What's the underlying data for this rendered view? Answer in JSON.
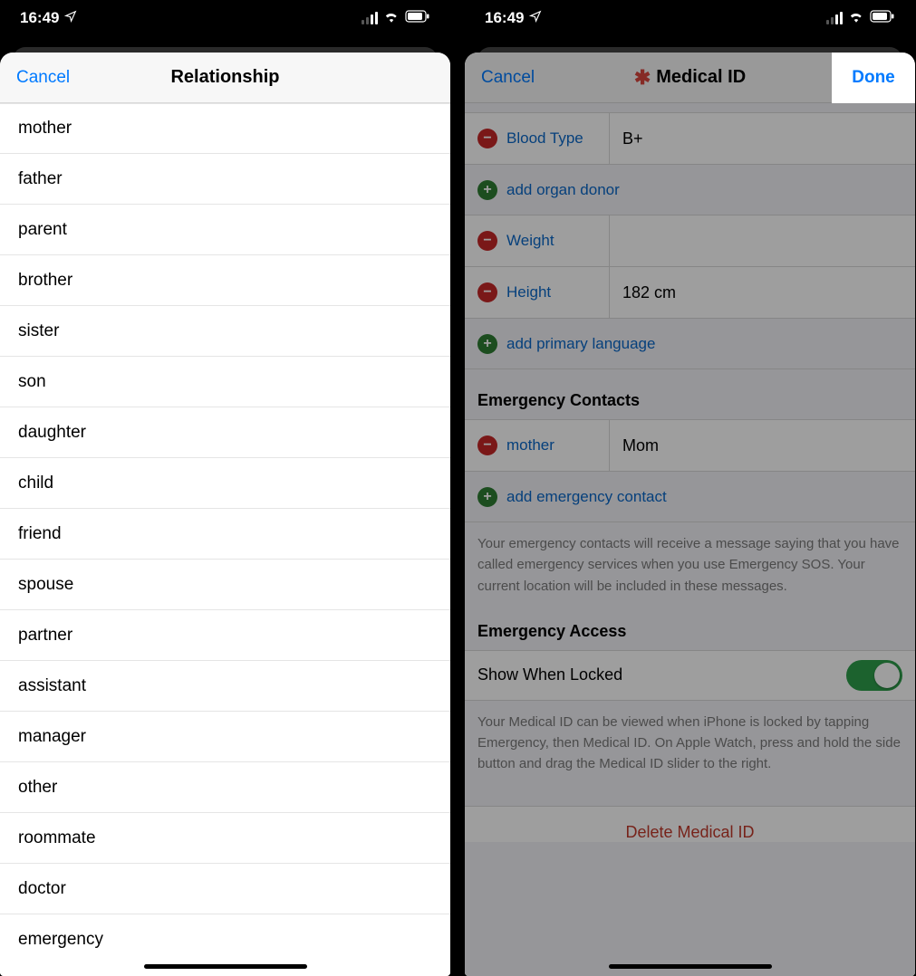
{
  "status": {
    "time": "16:49"
  },
  "left": {
    "cancel": "Cancel",
    "title": "Relationship",
    "items": [
      "mother",
      "father",
      "parent",
      "brother",
      "sister",
      "son",
      "daughter",
      "child",
      "friend",
      "spouse",
      "partner",
      "assistant",
      "manager",
      "other",
      "roommate",
      "doctor",
      "emergency"
    ]
  },
  "right": {
    "cancel": "Cancel",
    "done": "Done",
    "title": "Medical ID",
    "bloodType": {
      "label": "Blood Type",
      "value": "B+"
    },
    "addOrganDonor": "add organ donor",
    "weight": {
      "label": "Weight",
      "value": ""
    },
    "height": {
      "label": "Height",
      "value": "182 cm"
    },
    "addPrimaryLanguage": "add primary language",
    "emergencyContactsTitle": "Emergency Contacts",
    "contact": {
      "relationship": "mother",
      "name": "Mom"
    },
    "addEmergencyContact": "add emergency contact",
    "contactsFooter": "Your emergency contacts will receive a message saying that you have called emergency services when you use Emergency SOS. Your current location will be included in these messages.",
    "emergencyAccessTitle": "Emergency Access",
    "showWhenLocked": "Show When Locked",
    "accessFooter": "Your Medical ID can be viewed when iPhone is locked by tapping Emergency, then Medical ID. On Apple Watch, press and hold the side button and drag the Medical ID slider to the right.",
    "delete": "Delete Medical ID"
  }
}
